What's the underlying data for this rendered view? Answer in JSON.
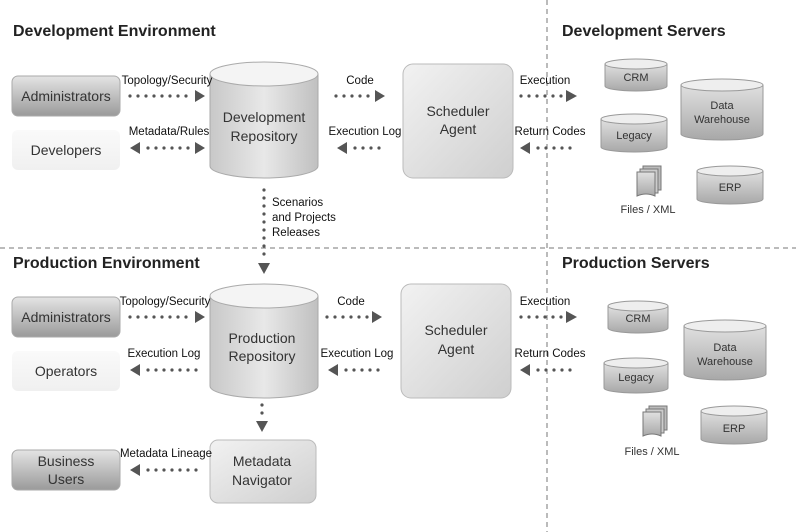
{
  "sections": {
    "dev_env": "Development Environment",
    "dev_servers": "Development Servers",
    "prod_env": "Production Environment",
    "prod_servers": "Production Servers"
  },
  "dev": {
    "administrators": "Administrators",
    "developers": "Developers",
    "repository": [
      "Development",
      "Repository"
    ],
    "scheduler": [
      "Scheduler",
      "Agent"
    ],
    "topology_label": "Topology/Security",
    "metadata_rules_label": "Metadata/Rules",
    "code_label": "Code",
    "execution_log_label": "Execution Log",
    "execution_label": "Execution",
    "return_codes_label": "Return Codes",
    "release_label": [
      "Scenarios",
      "and Projects",
      "Releases"
    ]
  },
  "prod": {
    "administrators": "Administrators",
    "operators": "Operators",
    "business_users": [
      "Business",
      "Users"
    ],
    "repository": [
      "Production",
      "Repository"
    ],
    "scheduler": [
      "Scheduler",
      "Agent"
    ],
    "navigator": [
      "Metadata",
      "Navigator"
    ],
    "topology_label": "Topology/Security",
    "execution_log_label_left": "Execution Log",
    "metadata_lineage_label": "Metadata Lineage",
    "code_label": "Code",
    "execution_log_label": "Execution Log",
    "execution_label": "Execution",
    "return_codes_label": "Return Codes"
  },
  "servers": {
    "crm": "CRM",
    "legacy": "Legacy",
    "data_warehouse": [
      "Data",
      "Warehouse"
    ],
    "erp": "ERP",
    "files": "Files / XML"
  }
}
